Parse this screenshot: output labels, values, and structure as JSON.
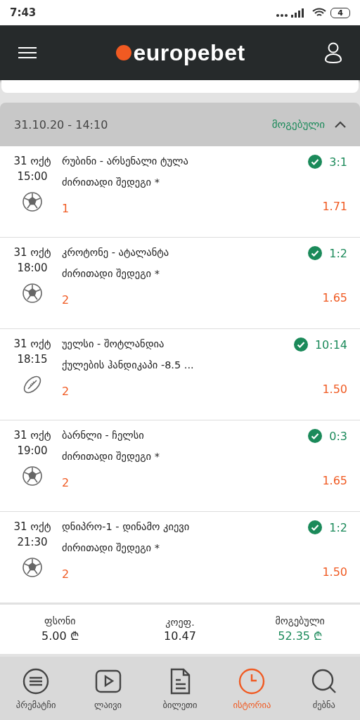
{
  "status_bar": {
    "time": "7:43",
    "battery": "4"
  },
  "header": {
    "logo": "europebet"
  },
  "bet": {
    "date": "31.10.20 - 14:10",
    "status": "მოგებული",
    "expanded": true,
    "events": [
      {
        "date": "31 ოქტ",
        "time": "15:00",
        "kind": "football",
        "match": "რუბინი - არსენალი ტულა",
        "market": "ძირითადი შედეგი *",
        "pick": "1",
        "odds": "1.71",
        "won": true,
        "score": "3:1"
      },
      {
        "date": "31 ოქტ",
        "time": "18:00",
        "kind": "football",
        "match": "კროტონე - ატალანტა",
        "market": "ძირითადი შედეგი *",
        "pick": "2",
        "odds": "1.65",
        "won": true,
        "score": "1:2"
      },
      {
        "date": "31 ოქტ",
        "time": "18:15",
        "kind": "rugby",
        "match": "უელსი - შოტლანდია",
        "market": "ქულების ჰანდიკაპი -8.5 ...",
        "pick": "2",
        "odds": "1.50",
        "won": true,
        "score": "10:14"
      },
      {
        "date": "31 ოქტ",
        "time": "19:00",
        "kind": "football",
        "match": "ბარნლი - ჩელსი",
        "market": "ძირითადი შედეგი *",
        "pick": "2",
        "odds": "1.65",
        "won": true,
        "score": "0:3"
      },
      {
        "date": "31 ოქტ",
        "time": "21:30",
        "kind": "football",
        "match": "დნიპრო-1 - დინამო კიევი",
        "market": "ძირითადი შედეგი *",
        "pick": "2",
        "odds": "1.50",
        "won": true,
        "score": "1:2"
      }
    ],
    "summary": [
      {
        "label": "ფსონი",
        "value": "5.00 ₾",
        "highlight": false
      },
      {
        "label": "კოეფ.",
        "value": "10.47",
        "highlight": false
      },
      {
        "label": "მოგებული",
        "value": "52.35 ₾",
        "highlight": true
      }
    ]
  },
  "nav": [
    {
      "label": "პრემატჩი",
      "selected": false
    },
    {
      "label": "ლაივი",
      "selected": false
    },
    {
      "label": "ბილეთი",
      "selected": false
    },
    {
      "label": "ისტორია",
      "selected": true
    },
    {
      "label": "ძებნა",
      "selected": false
    }
  ]
}
